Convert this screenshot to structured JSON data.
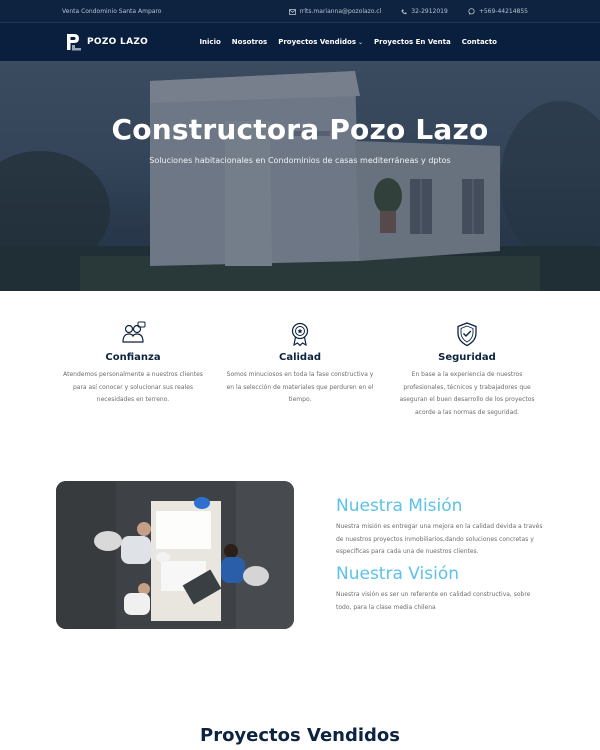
{
  "topbar": {
    "left_text": "Venta Condominio Santa Amparo",
    "email": "rrlts.marianna@pozolazo.cl",
    "phone": "32-2912019",
    "whatsapp": "+569-44214855"
  },
  "nav": {
    "logo_text": "POZO LAZO",
    "menu": [
      {
        "label": "Inicio"
      },
      {
        "label": "Nosotros"
      },
      {
        "label": "Proyectos Vendidos",
        "has_dropdown": true
      },
      {
        "label": "Proyectos En Venta"
      },
      {
        "label": "Contacto"
      }
    ]
  },
  "hero": {
    "title": "Constructora Pozo Lazo",
    "subtitle": "Soluciones habitacionales en Condominios de casas mediterráneas y dptos"
  },
  "features": [
    {
      "icon": "handshake-team-icon",
      "title": "Confianza",
      "text": "Atendemos personalmente a nuestros clientes para así conocer y solucionar sus reales necesidades en terreno."
    },
    {
      "icon": "award-medal-icon",
      "title": "Calidad",
      "text": "Somos minuciosos en toda la fase constructiva y en la selección de materiales que perduren en el tiempo."
    },
    {
      "icon": "shield-check-icon",
      "title": "Seguridad",
      "text": "En base a la experiencia de nuestros profesionales, técnicos y trabajadores que aseguran el buen desarrollo de los proyectos acorde a las normas de seguridad."
    }
  ],
  "mision": {
    "title": "Nuestra Misión",
    "text": "Nuestra misión es entregar una mejora en la calidad devida a través de nuestros proyectos inmobiliarios,dando soluciones concretas y específicas para cada una de nuestros clientes."
  },
  "vision": {
    "title": "Nuestra Visión",
    "text": "Nuestra visión es ser un referente en calidad constructiva, sobre todo, para la clase media chilena"
  },
  "section": {
    "title": "Proyectos Vendidos"
  },
  "colors": {
    "navy": "#0a1f3d",
    "accent_blue": "#5cc2e8"
  }
}
